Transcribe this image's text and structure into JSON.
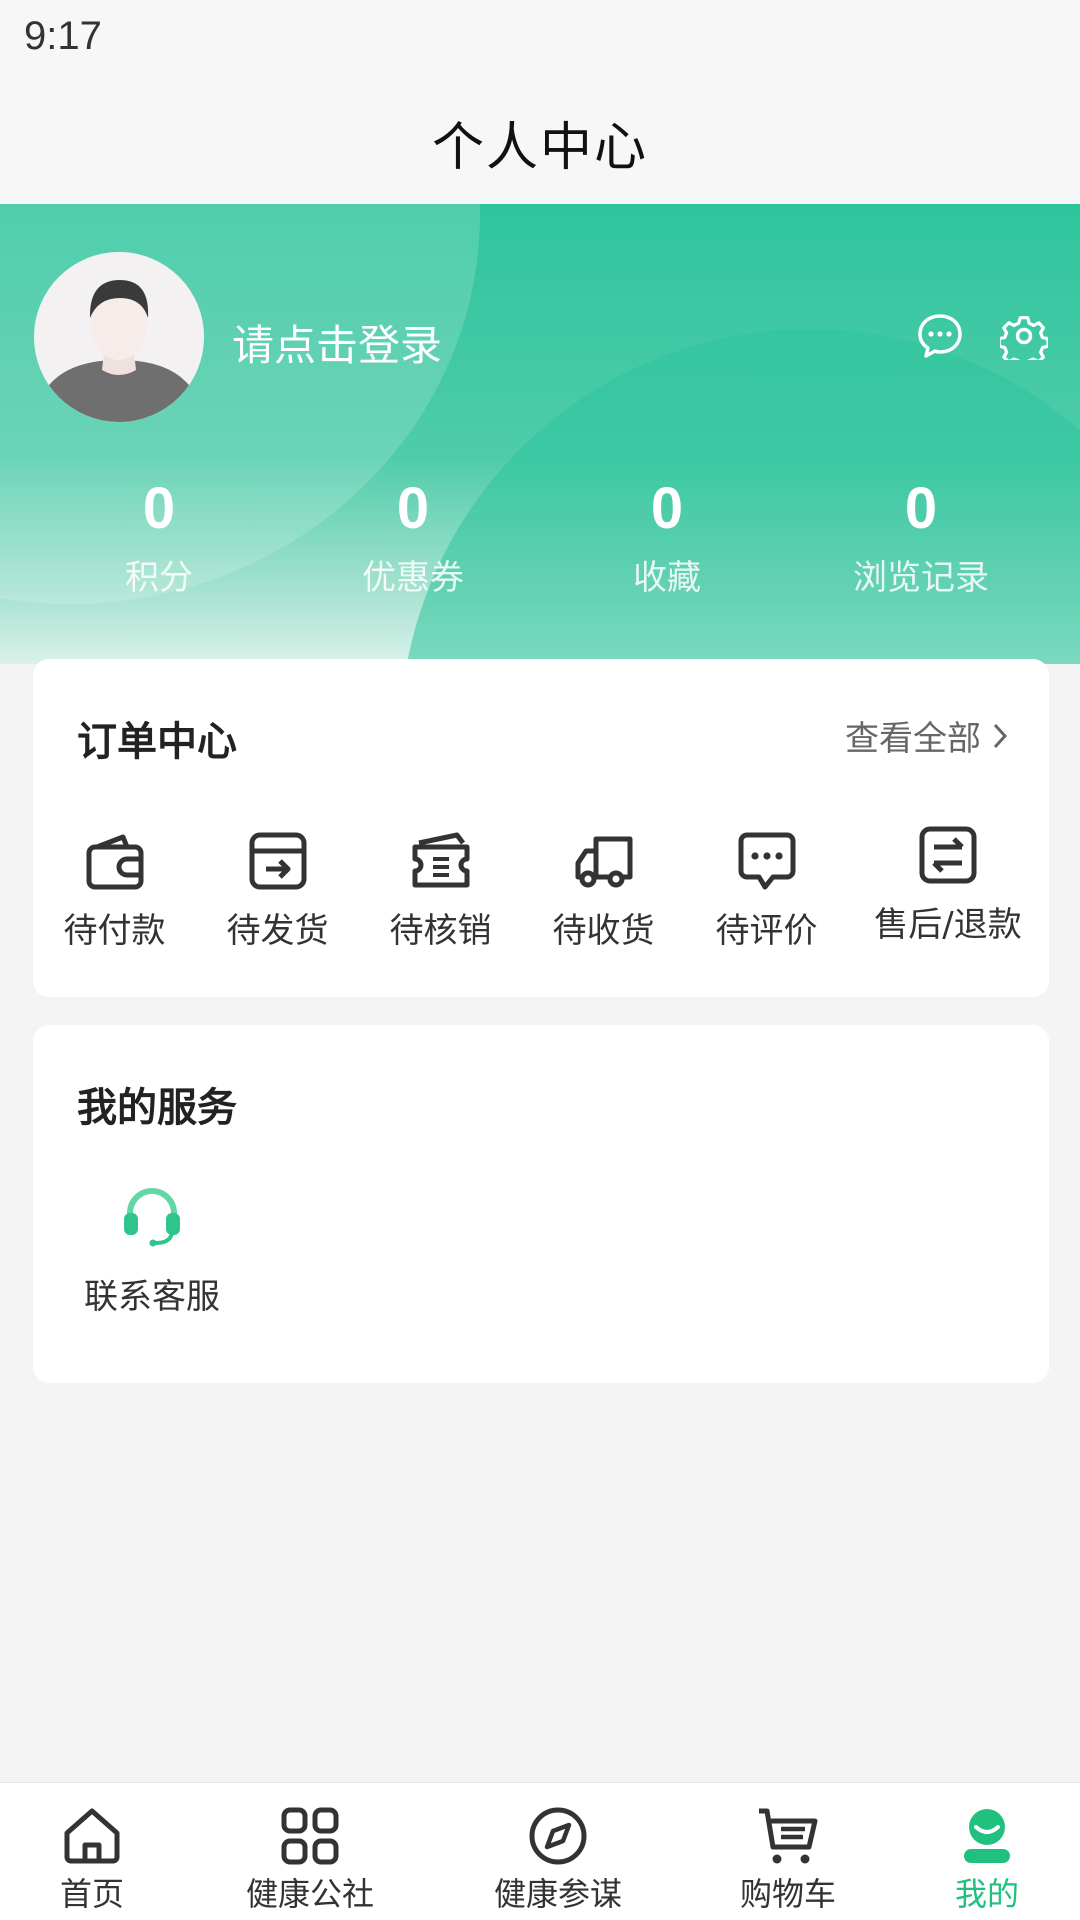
{
  "status_bar": {
    "time": "9:17"
  },
  "header": {
    "title": "个人中心"
  },
  "profile": {
    "login_prompt": "请点击登录",
    "icons": [
      "message-icon",
      "settings-icon"
    ],
    "stats": [
      {
        "value": "0",
        "label": "积分"
      },
      {
        "value": "0",
        "label": "优惠券"
      },
      {
        "value": "0",
        "label": "收藏"
      },
      {
        "value": "0",
        "label": "浏览记录"
      }
    ]
  },
  "orders": {
    "title": "订单中心",
    "view_all": "查看全部",
    "items": [
      {
        "label": "待付款",
        "icon": "wallet-icon"
      },
      {
        "label": "待发货",
        "icon": "box-icon"
      },
      {
        "label": "待核销",
        "icon": "ticket-icon"
      },
      {
        "label": "待收货",
        "icon": "truck-icon"
      },
      {
        "label": "待评价",
        "icon": "comment-icon"
      },
      {
        "label": "售后/退款",
        "icon": "exchange-icon"
      }
    ]
  },
  "services": {
    "title": "我的服务",
    "items": [
      {
        "label": "联系客服",
        "icon": "headset-icon"
      }
    ]
  },
  "tabbar": {
    "items": [
      {
        "label": "首页",
        "icon": "home-icon"
      },
      {
        "label": "健康公社",
        "icon": "grid-icon"
      },
      {
        "label": "健康参谋",
        "icon": "compass-icon"
      },
      {
        "label": "购物车",
        "icon": "cart-icon"
      },
      {
        "label": "我的",
        "icon": "user-icon",
        "active": true
      }
    ]
  },
  "colors": {
    "brand_green": "#2ec59d",
    "active_tab": "#20c07f",
    "text_dark": "#222222"
  }
}
